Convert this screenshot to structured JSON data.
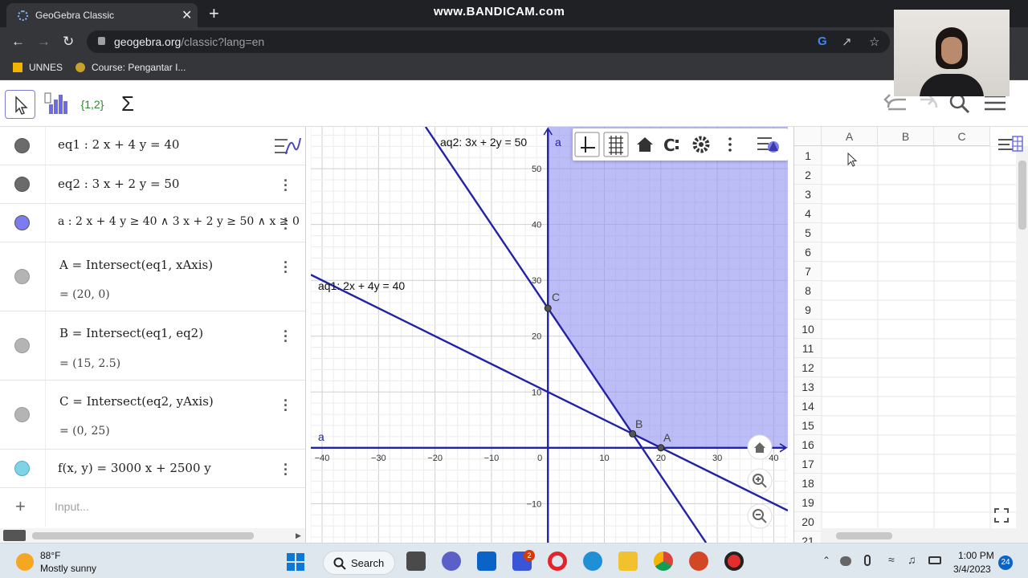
{
  "browser": {
    "tab_title": "GeoGebra Classic",
    "tab_close": "✕",
    "new_tab": "+",
    "url_host": "geogebra.org",
    "url_path": "/classic?lang=en",
    "watermark": "www.BANDICAM.com",
    "bookmarks": [
      "UNNES",
      "Course: Pengantar I..."
    ]
  },
  "geogebra": {
    "toolbar": {
      "list_tool": "{1,2}",
      "sum_tool": "Σ"
    },
    "algebra": [
      {
        "color": "#6b6b6b",
        "line1": "eq1 :  2 x + 4 y  =  40",
        "line2": ""
      },
      {
        "color": "#6b6b6b",
        "line1": "eq2 :  3 x + 2 y  =  50",
        "line2": ""
      },
      {
        "color": "#7b7bf2",
        "line1": "a :  2 x + 4 y ≥ 40 ∧ 3 x + 2 y ≥ 50 ∧ x ≥ 0",
        "line2": ""
      },
      {
        "color": "#b4b4b4",
        "line1": "A  =  Intersect(eq1, xAxis)",
        "line2": "=  (20,  0)"
      },
      {
        "color": "#b4b4b4",
        "line1": "B  =  Intersect(eq1, eq2)",
        "line2": "=  (15,  2.5)"
      },
      {
        "color": "#b4b4b4",
        "line1": "C  =  Intersect(eq2, yAxis)",
        "line2": "=  (0,  25)"
      },
      {
        "color": "#7fd3e6",
        "line1": "f(x, y)  =  3000 x + 2500 y",
        "line2": ""
      }
    ],
    "input_placeholder": "Input...",
    "add_symbol": "+",
    "graphics": {
      "labels": {
        "aq2": "aq2: 3x + 2y = 50",
        "aq1": "aq1: 2x + 4y = 40",
        "a_top": "a",
        "a_left": "a",
        "A": "A",
        "B": "B",
        "C": "C"
      },
      "x_ticks": [
        -40,
        -30,
        -20,
        -10,
        0,
        10,
        20,
        30,
        40
      ],
      "y_ticks": [
        -10,
        10,
        20,
        30,
        40,
        50
      ],
      "tick_labels_x": [
        "−40",
        "−30",
        "−20",
        "−10",
        "0",
        "10",
        "20",
        "30",
        "40"
      ],
      "tick_labels_y": [
        "−10",
        "10",
        "20",
        "30",
        "40",
        "50"
      ],
      "region_color": "#8f8ff2",
      "line_color": "#2222a8",
      "points": [
        {
          "name": "A",
          "x": 20,
          "y": 0
        },
        {
          "name": "B",
          "x": 15,
          "y": 2.5
        },
        {
          "name": "C",
          "x": 0,
          "y": 25
        }
      ],
      "x_range": [
        -42,
        42.5
      ],
      "y_range": [
        -17,
        57.5
      ]
    },
    "spreadsheet": {
      "columns": [
        "A",
        "B",
        "C"
      ],
      "rows": [
        "1",
        "2",
        "3",
        "4",
        "5",
        "6",
        "7",
        "8",
        "9",
        "10",
        "11",
        "12",
        "13",
        "14",
        "15",
        "16",
        "17",
        "18",
        "19",
        "20",
        "21"
      ]
    }
  },
  "taskbar": {
    "weather_temp": "88°F",
    "weather_desc": "Mostly sunny",
    "search_label": "Search",
    "time": "1:00 PM",
    "date": "3/4/2023",
    "teams_badge": "2",
    "notif_badge": "24"
  }
}
